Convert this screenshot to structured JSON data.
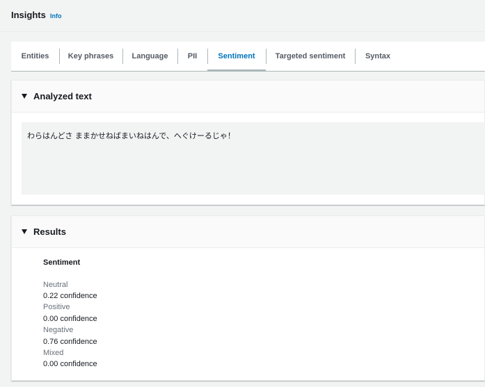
{
  "header": {
    "title": "Insights",
    "info_link": "Info"
  },
  "tabs": [
    {
      "label": "Entities",
      "active": false
    },
    {
      "label": "Key phrases",
      "active": false
    },
    {
      "label": "Language",
      "active": false
    },
    {
      "label": "PII",
      "active": false
    },
    {
      "label": "Sentiment",
      "active": true
    },
    {
      "label": "Targeted sentiment",
      "active": false
    },
    {
      "label": "Syntax",
      "active": false
    }
  ],
  "analyzed_text": {
    "title": "Analyzed text",
    "text": "わらはんどさ ままかせねばまいねはんで、へぐけーるじゃ！"
  },
  "results": {
    "title": "Results",
    "heading": "Sentiment",
    "items": [
      {
        "label": "Neutral",
        "value": "0.22 confidence"
      },
      {
        "label": "Positive",
        "value": "0.00 confidence"
      },
      {
        "label": "Negative",
        "value": "0.76 confidence"
      },
      {
        "label": "Mixed",
        "value": "0.00 confidence"
      }
    ]
  },
  "colors": {
    "link": "#0073bb",
    "text": "#16191f",
    "secondary_text": "#687078",
    "background": "#f2f3f3"
  }
}
